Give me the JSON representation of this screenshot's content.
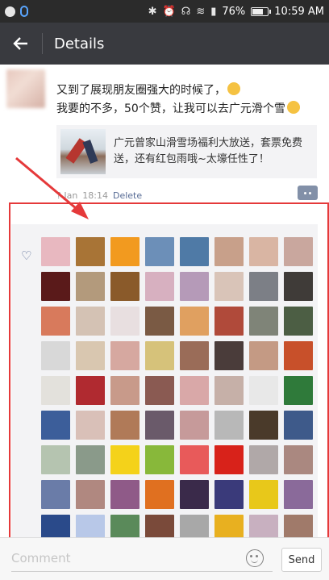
{
  "status_bar": {
    "battery": "76%",
    "battery_level": 0.76,
    "time": "10:59 AM",
    "icons": [
      "bluetooth-icon",
      "alarm-icon",
      "headset-icon",
      "wifi-icon",
      "signal-icon"
    ]
  },
  "header": {
    "title": "Details"
  },
  "post": {
    "text_line1": "又到了展现朋友圈强大的时候了，",
    "text_line2": "我要的不多，50个赞，让我可以去广元滑个雪",
    "card_text": "广元曾家山滑雪场福利大放送，套票免费送，还有红包雨哦~太壕任性了！",
    "date": "? Jan",
    "time": "18:14",
    "delete_label": "Delete"
  },
  "likes": {
    "avatar_colors": [
      "#e8b8c0",
      "#a87436",
      "#f29a1f",
      "#6c8fb8",
      "#4f7aa6",
      "#c8a08a",
      "#d9b5a3",
      "#c9a79e",
      "#5a1a1a",
      "#b39a7c",
      "#8a5a2a",
      "#d7b0c0",
      "#b59ab8",
      "#d9c4b8",
      "#7c7f86",
      "#3f3b38",
      "#d87a5c",
      "#d4c2b4",
      "#e8dfe0",
      "#7a5a44",
      "#e0a060",
      "#b04a3a",
      "#7f8478",
      "#4c5e44",
      "#d8d8d8",
      "#d9c7b0",
      "#d6a8a0",
      "#d6c27a",
      "#9a6c58",
      "#4a3c3a",
      "#c49a84",
      "#c8502a",
      "#e3e1dc",
      "#b02a30",
      "#c89a8a",
      "#8a5a52",
      "#d9a8a8",
      "#c6b0a8",
      "#e8e8e8",
      "#2f7a3a",
      "#3c5e9a",
      "#d9c0b8",
      "#b07a58",
      "#6a5a6a",
      "#c69a9a",
      "#b8b8b8",
      "#4a3a2a",
      "#3e5a8a",
      "#b5c4b0",
      "#8a9a8a",
      "#f4d21a",
      "#88b83a",
      "#e85a5a",
      "#d8221a",
      "#b0a8a8",
      "#aa8880",
      "#6a7ca8",
      "#b08880",
      "#8f5a88",
      "#e07020",
      "#3a2a4a",
      "#3a3a7a",
      "#e8c81a",
      "#8a6a9a",
      "#2a4a8a",
      "#b8c8e8",
      "#5a8a5a",
      "#7a4a3a",
      "#a8a8a8",
      "#e8b020",
      "#c8b0c0",
      "#a07a6a"
    ]
  },
  "comment_bar": {
    "placeholder": "Comment",
    "send_label": "Send"
  },
  "colors": {
    "status_bar_bg": "#2b2b2b",
    "title_bar_bg": "#393a3f",
    "link_blue": "#576b95",
    "annotation_red": "#e5393a"
  }
}
